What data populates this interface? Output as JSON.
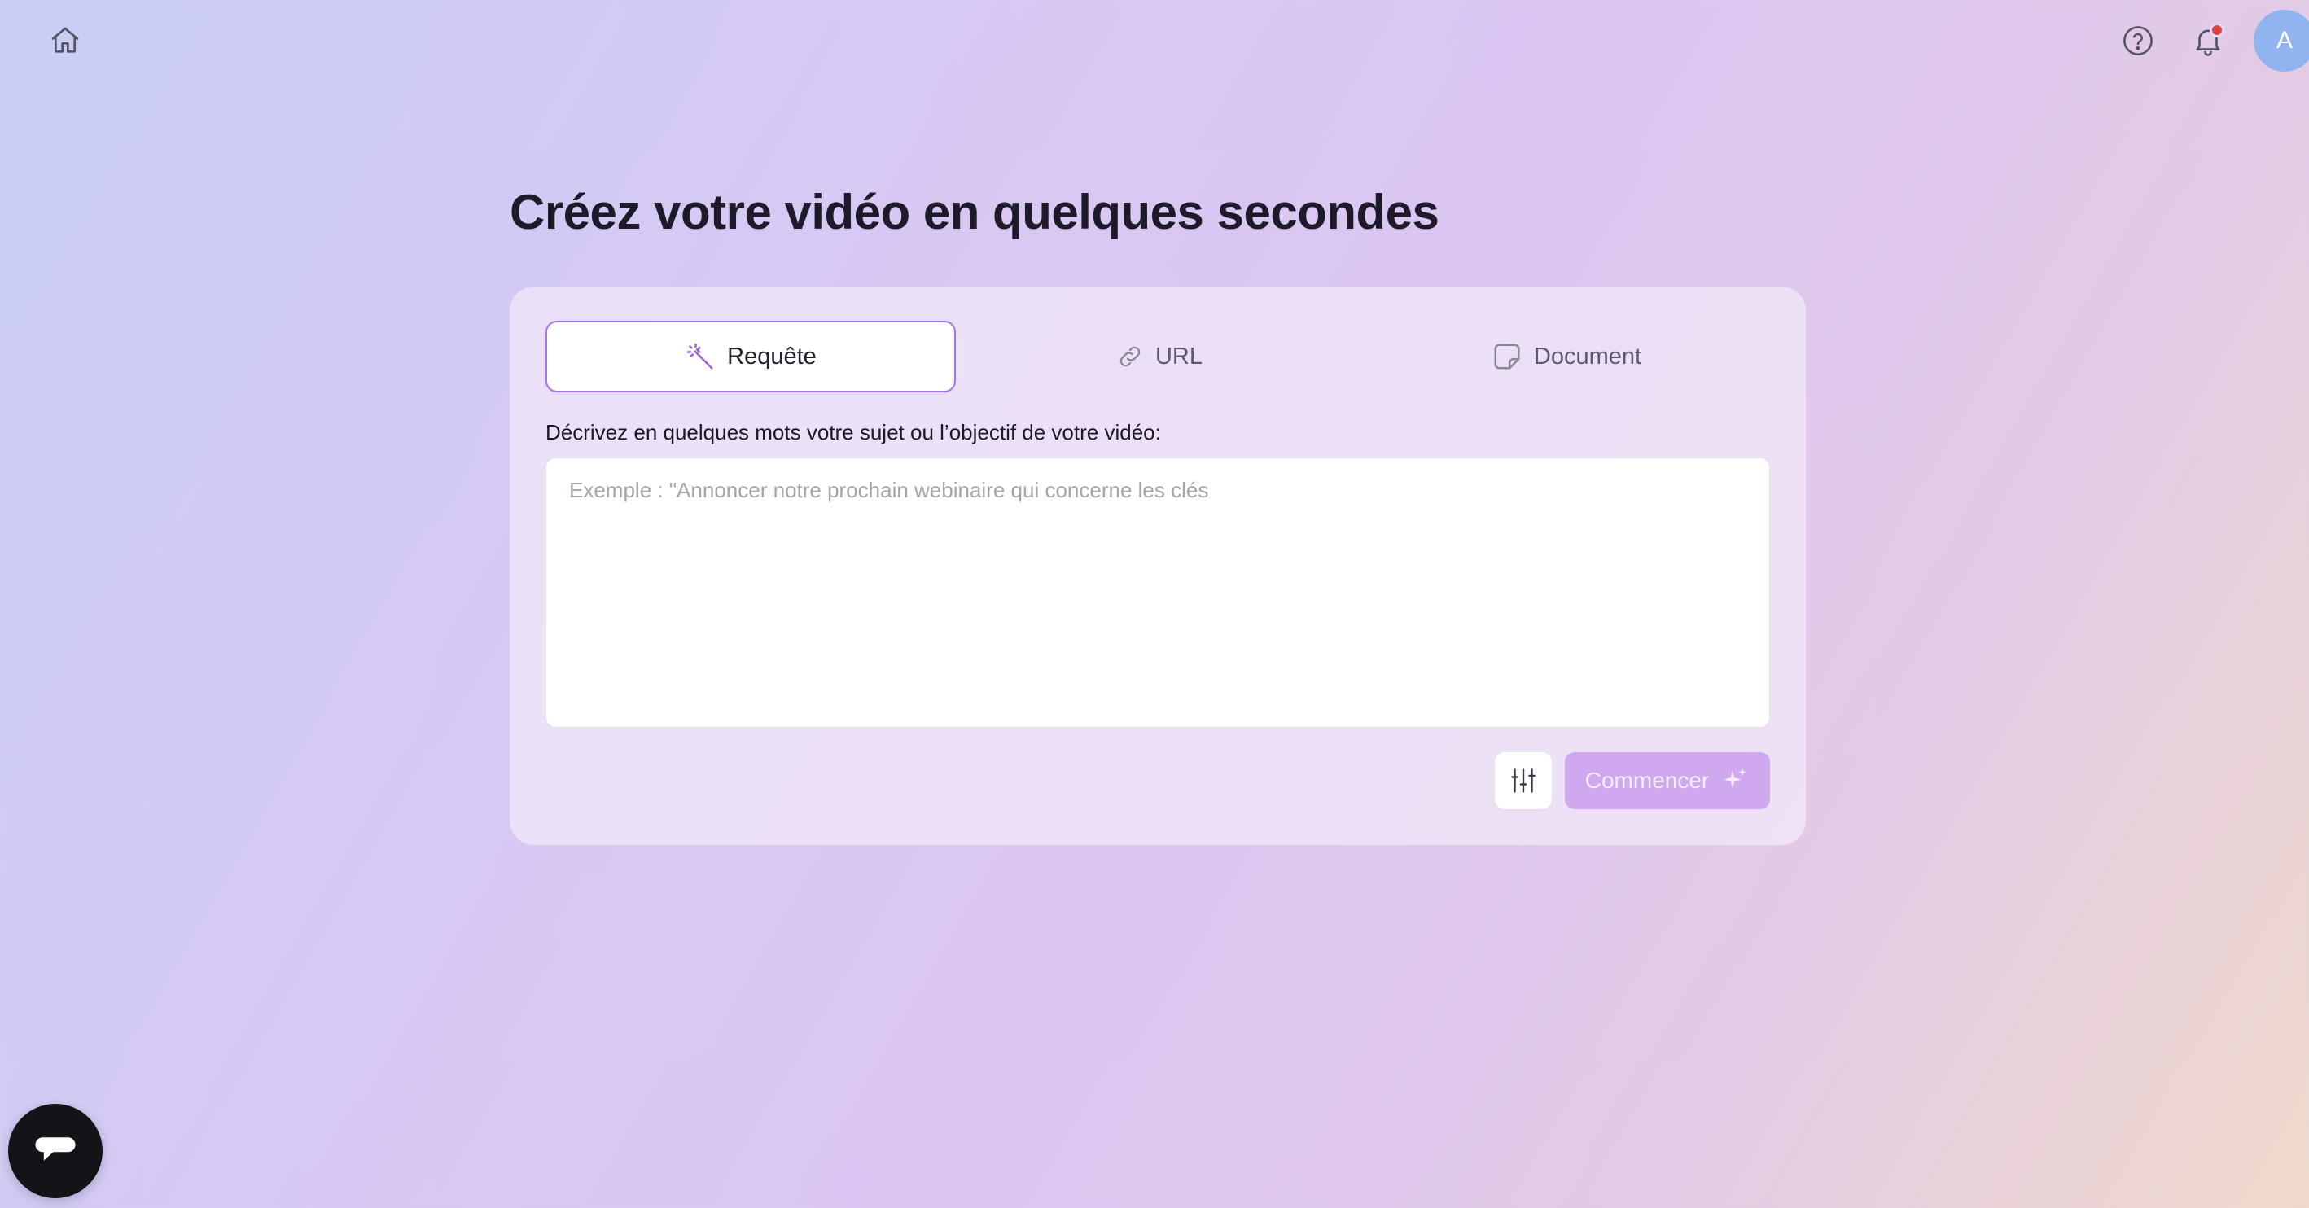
{
  "header": {
    "home_icon": "home-icon",
    "help_icon": "help-circle-icon",
    "bell_icon": "bell-icon",
    "notification_dot_color": "#d9443d",
    "avatar_initial": "A",
    "avatar_color": "#8fb4f0"
  },
  "title": "Créez votre vidéo en quelques secondes",
  "tabs": [
    {
      "label": "Requête",
      "icon": "magic-wand-icon",
      "active": true
    },
    {
      "label": "URL",
      "icon": "link-icon",
      "active": false
    },
    {
      "label": "Document",
      "icon": "document-icon",
      "active": false
    }
  ],
  "prompt": {
    "label": "Décrivez en quelques mots votre sujet ou l’objectif de votre vidéo:",
    "value": "",
    "placeholder": "Exemple : \"Annoncer notre prochain webinaire qui concerne les clés"
  },
  "actions": {
    "settings_icon": "sliders-icon",
    "start_label": "Commencer",
    "start_icon": "sparkles-icon"
  },
  "colors": {
    "accent": "#a776e6",
    "start_button": "#cfa9ef",
    "chat_launcher": "#131318"
  },
  "chat": {
    "icon": "chat-bubble-icon"
  }
}
